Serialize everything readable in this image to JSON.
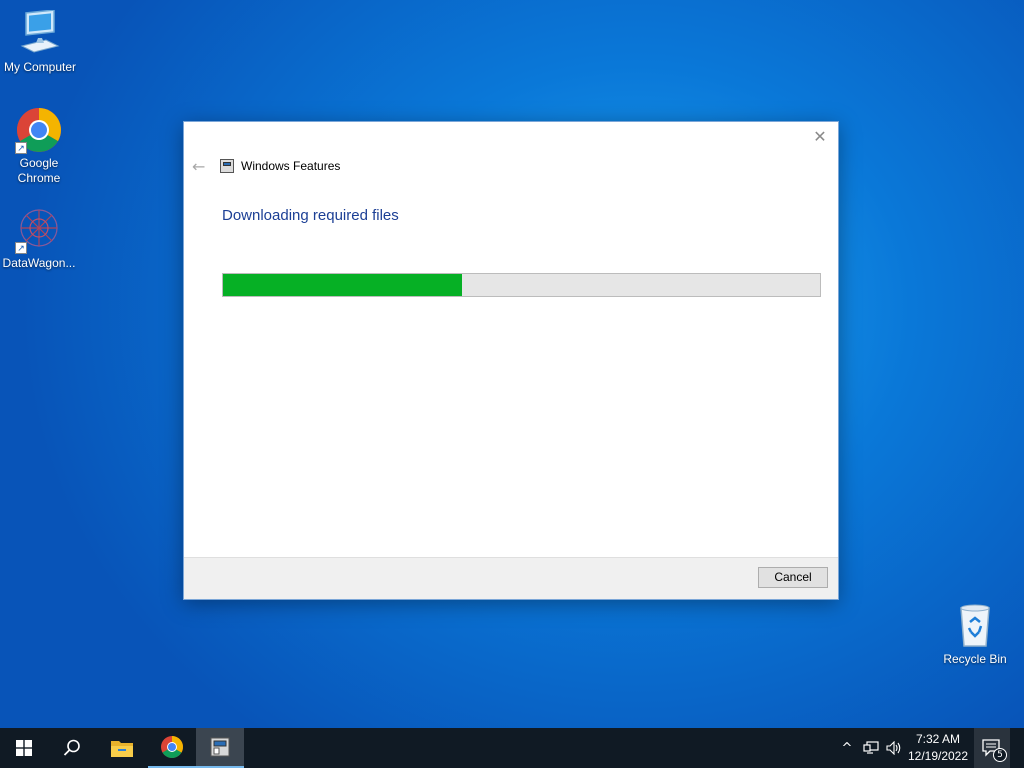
{
  "desktop": {
    "icons": [
      {
        "label": "My Computer",
        "icon": "computer-icon"
      },
      {
        "label": "Google Chrome",
        "icon": "chrome-icon"
      },
      {
        "label": "DataWagon...",
        "icon": "datawagon-icon"
      },
      {
        "label": "Recycle Bin",
        "icon": "recycle-bin-icon"
      }
    ]
  },
  "dialog": {
    "title": "Windows Features",
    "heading": "Downloading required files",
    "progress_percent": 40,
    "cancel_label": "Cancel",
    "close_glyph": "✕",
    "back_glyph": "←",
    "accent_color": "#06b025",
    "heading_color": "#1c3f95"
  },
  "taskbar": {
    "items": [
      "windows-start-icon",
      "search-icon",
      "file-explorer-icon",
      "chrome-icon",
      "windows-features-icon"
    ],
    "tray": {
      "chevron_glyph": "^",
      "time": "7:32 AM",
      "date": "12/19/2022",
      "notification_count": "5"
    }
  }
}
